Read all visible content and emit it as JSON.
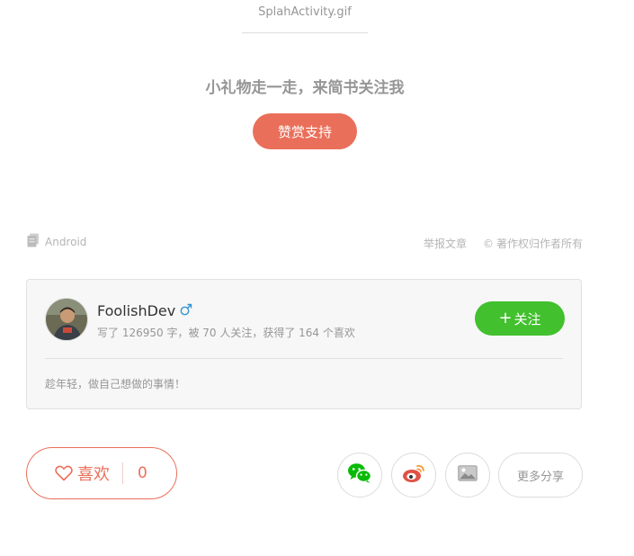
{
  "image_caption": "SplahActivity.gif",
  "reward": {
    "title": "小礼物走一走，来简书关注我",
    "button_label": "赞赏支持"
  },
  "article_meta": {
    "notebook": "Android",
    "report": "举报文章",
    "copyright_symbol": "©",
    "copyright": "著作权归作者所有"
  },
  "author": {
    "name": "FoolishDev",
    "gender_icon": "male-icon",
    "stats": "写了 126950 字，被 70 人关注，获得了 164 个喜欢",
    "follow_label": "关注",
    "follow_plus": "+",
    "bio": "趁年轻，做自己想做的事情！"
  },
  "actions": {
    "like_label": "喜欢",
    "like_count": "0",
    "more_share": "更多分享"
  },
  "colors": {
    "accent": "#ea6f5a",
    "follow_green": "#42c02e",
    "muted_text": "#969696",
    "wechat": "#09bb07",
    "weibo": "#e05244",
    "male_blue": "#3194d0"
  }
}
